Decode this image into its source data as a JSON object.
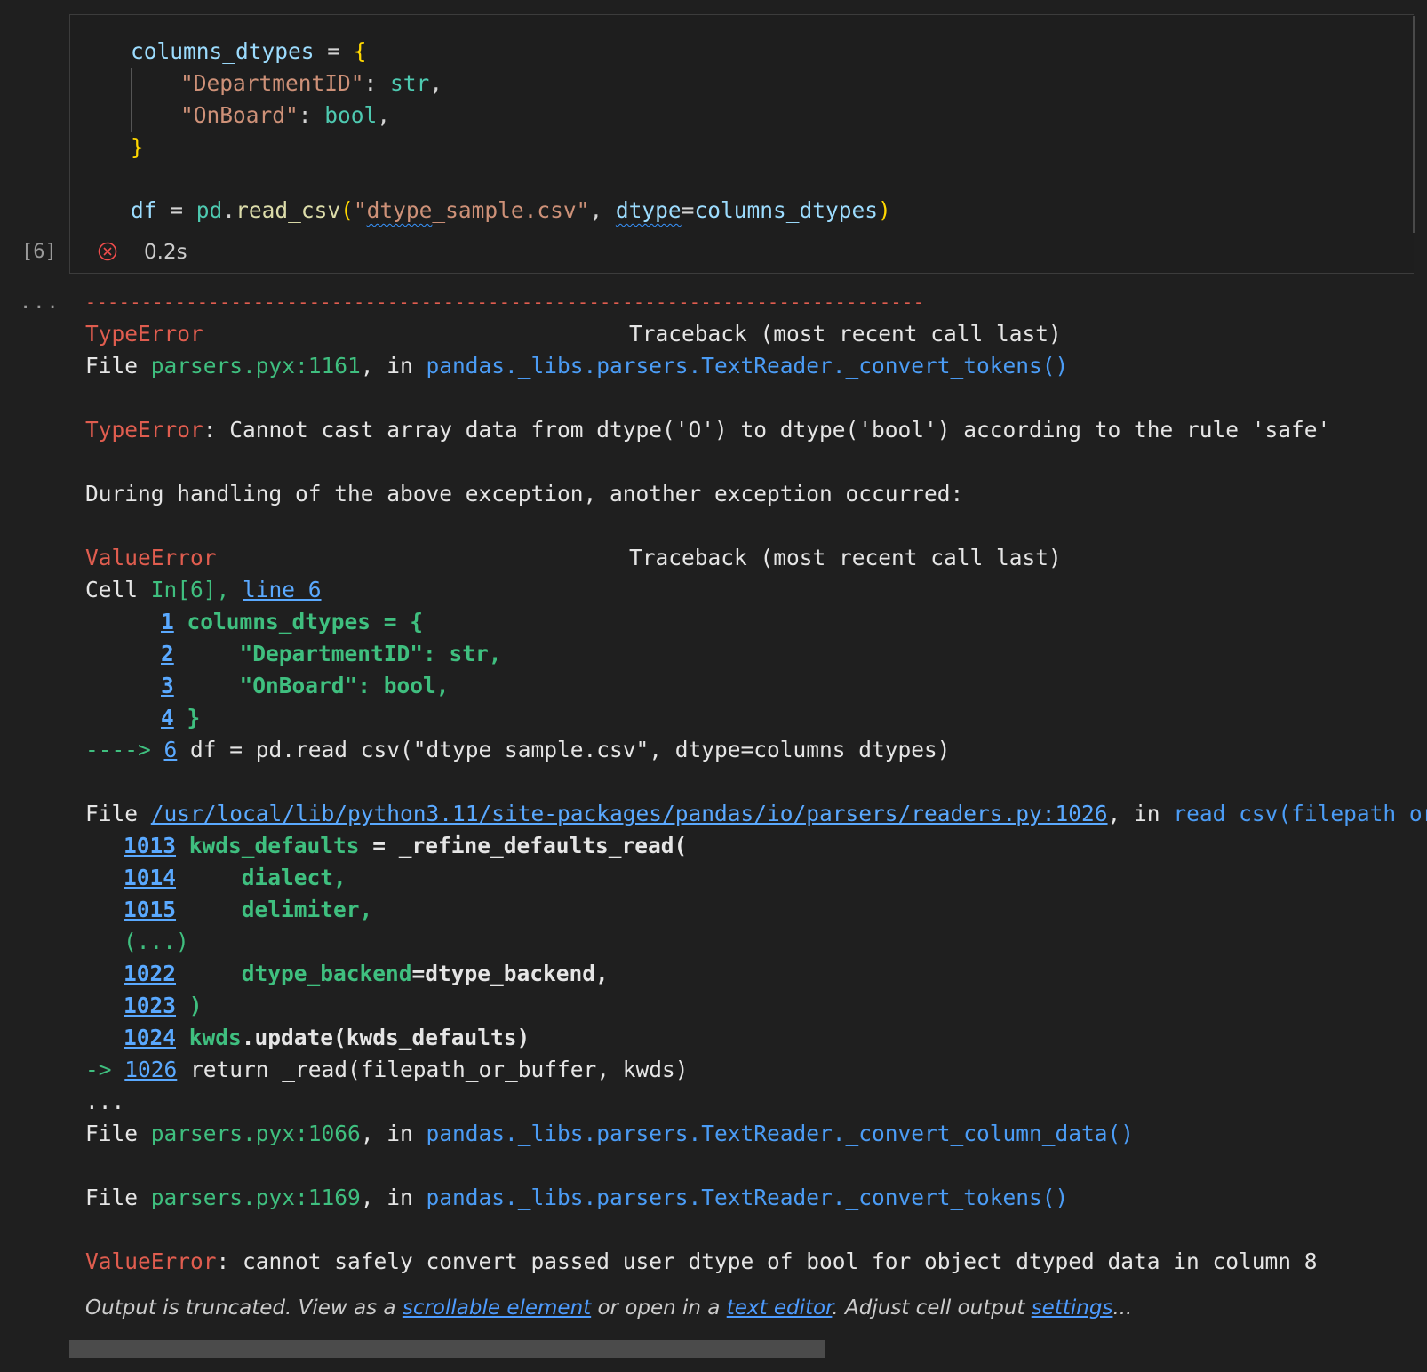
{
  "cell": {
    "execution_count": "[6]",
    "time": "0.2s",
    "status": "error",
    "source": {
      "l1_var": "columns_dtypes",
      "l1_op": " = ",
      "l1_brace": "{",
      "l2_key": "\"DepartmentID\"",
      "l2_sep": ": ",
      "l2_type": "str",
      "l2_end": ",",
      "l3_key": "\"OnBoard\"",
      "l3_sep": ": ",
      "l3_type": "bool",
      "l3_end": ",",
      "l4_brace": "}",
      "l6_var": "df",
      "l6_op": " = ",
      "l6_mod": "pd",
      "l6_dot": ".",
      "l6_fn": "read_csv",
      "l6_paren_open": "(",
      "l6_str_q": "\"",
      "l6_str_squig": "dtype",
      "l6_str_rest": "_sample.csv\"",
      "l6_comma": ", ",
      "l6_kw": "dtype",
      "l6_eq": "=",
      "l6_arg": "columns_dtypes",
      "l6_paren_close": ")"
    }
  },
  "output": {
    "ellipsis": "...",
    "dash_line": "---------------------------------------------------------------------------",
    "t1_name": "TypeError",
    "t1_header": "Traceback (most recent call last)",
    "f1_prefix": "File ",
    "f1_file": "parsers.pyx:1161",
    "f1_in": ", in ",
    "f1_func": "pandas._libs.parsers.TextReader._convert_tokens()",
    "t1_msg_name": "TypeError",
    "t1_msg": ": Cannot cast array data from dtype('O') to dtype('bool') according to the rule 'safe'",
    "during": "During handling of the above exception, another exception occurred:",
    "t2_name": "ValueError",
    "t2_header": "Traceback (most recent call last)",
    "cell_prefix": "Cell ",
    "cell_ref": "In[6], ",
    "cell_line_link": "line 6",
    "src1_no": "1",
    "src1_code": " columns_dtypes = {",
    "src2_no": "2",
    "src2_code": "     \"DepartmentID\": str,",
    "src3_no": "3",
    "src3_code": "     \"OnBoard\": bool,",
    "src4_no": "4",
    "src4_code": " }",
    "src6_arrow": "----> ",
    "src6_no": "6",
    "src6_code": " df = pd.read_csv(\"dtype_sample.csv\", dtype=columns_dtypes)",
    "f2_prefix": "File ",
    "f2_path": "/usr/local/lib/python3.11/site-packages/pandas/io/parsers/readers.py:1026",
    "f2_in": ", in ",
    "f2_func": "read_csv(filepath_or_buffer, sep, delimiter, header, names, index_col, usecols, dtype, engine, converters, true_values, false_values, skipinitialspace, skiprows, skipfooter, nrows, na_values, keep_default_na, na_filter, verbose, skip_blank_lines, parse_dates, infer_datetime_format, keep_date_col, date_parser, date_format, dayfirst, cache_dates, iterator, chunksize, compression, thousands, decimal, lineterminator, quotechar, quoting, doublequote, escapechar, comment, encoding, encoding_errors, dialect, on_bad_lines, delim_whitespace, low_memory, memory_map, float_precision, storage_options, dtype_backend)",
    "r1013_no": "1013",
    "r1013_a": " kwds_defaults",
    "r1013_b": " = _refine_defaults_read(",
    "r1014_no": "1014",
    "r1014_a": "     dialect,",
    "r1015_no": "1015",
    "r1015_a": "     delimiter,",
    "r_skip": "(...)",
    "r1022_no": "1022",
    "r1022_a": "     dtype_backend",
    "r1022_b": "=dtype_backend,",
    "r1023_no": "1023",
    "r1023_a": " )",
    "r1024_no": "1024",
    "r1024_a": " kwds",
    "r1024_b": ".update(kwds_defaults)",
    "r1026_arrow": "-> ",
    "r1026_no": "1026",
    "r1026_code": " return _read(filepath_or_buffer, kwds)",
    "dots": "...",
    "f3_prefix": "File ",
    "f3_file": "parsers.pyx:1066",
    "f3_in": ", in ",
    "f3_func": "pandas._libs.parsers.TextReader._convert_column_data()",
    "f4_prefix": "File ",
    "f4_file": "parsers.pyx:1169",
    "f4_in": ", in ",
    "f4_func": "pandas._libs.parsers.TextReader._convert_tokens()",
    "final_name": "ValueError",
    "final_msg": ": cannot safely convert passed user dtype of bool for object dtyped data in column 8",
    "trunc_a": "Output is truncated. View as a ",
    "trunc_link1": "scrollable element",
    "trunc_b": " or open in a ",
    "trunc_link2": "text editor",
    "trunc_c": ". Adjust cell output ",
    "trunc_link3": "settings",
    "trunc_d": "..."
  }
}
